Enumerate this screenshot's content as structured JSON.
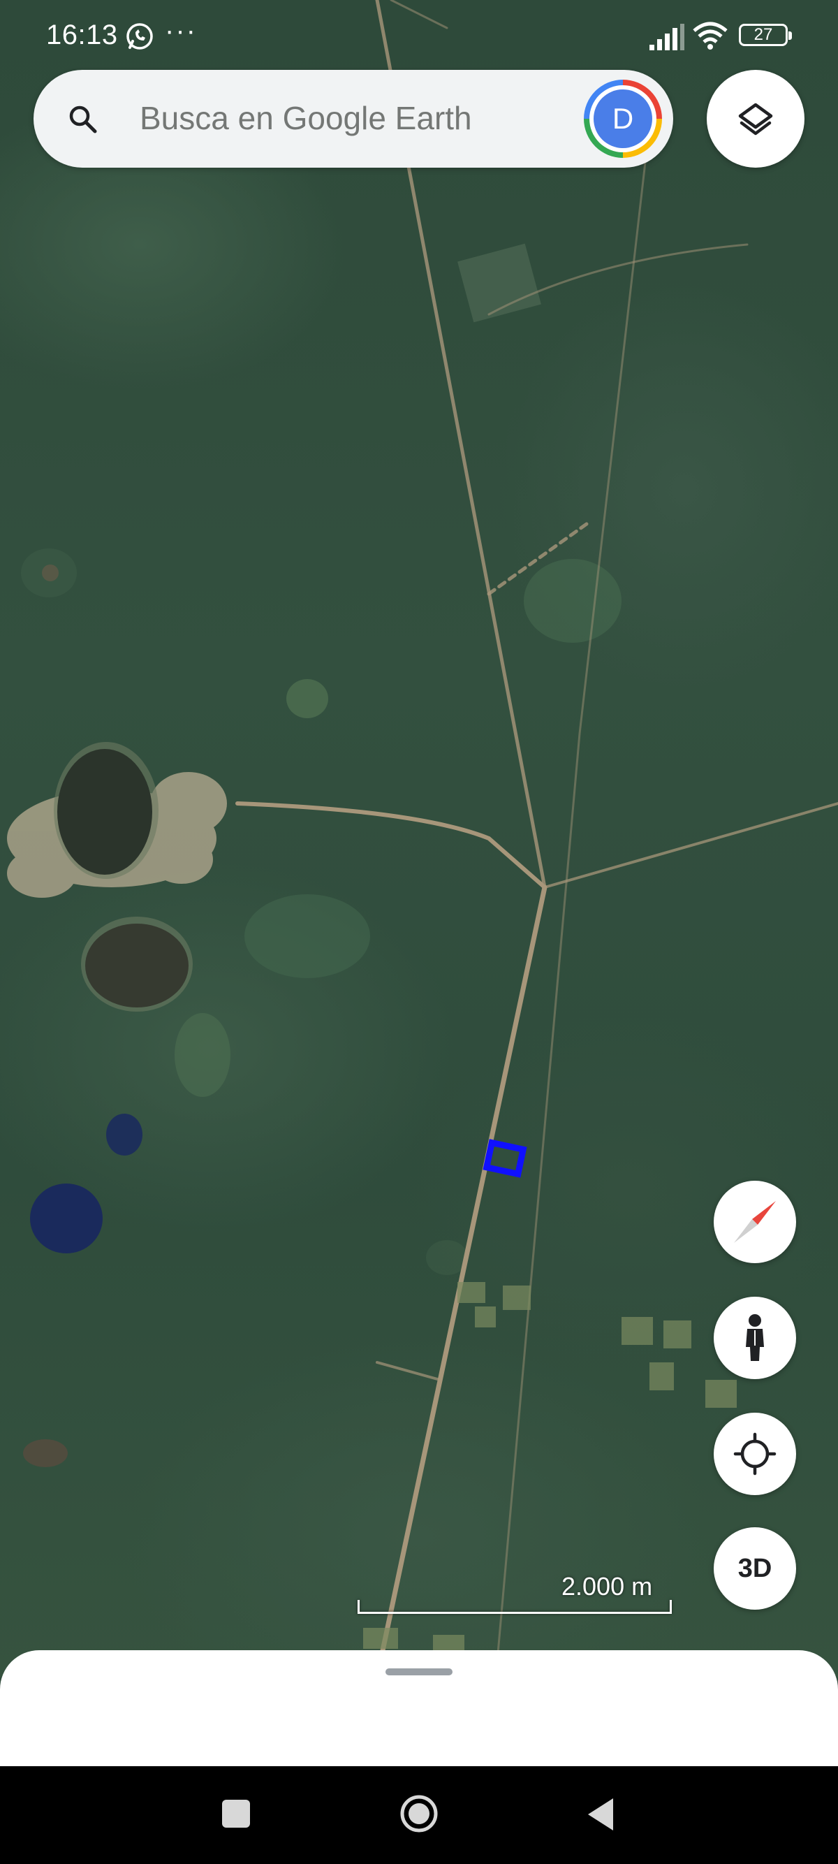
{
  "status_bar": {
    "time": "16:13",
    "more_dots": "···",
    "battery": "27"
  },
  "search": {
    "placeholder": "Busca en Google Earth",
    "avatar_letter": "D"
  },
  "controls": {
    "view3d_label": "3D"
  },
  "map": {
    "scale_label": "2.000 m",
    "selection_color": "#1010ff"
  },
  "colors": {
    "avatar_bg": "#4a7ee8",
    "compass_red": "#e8453c"
  }
}
